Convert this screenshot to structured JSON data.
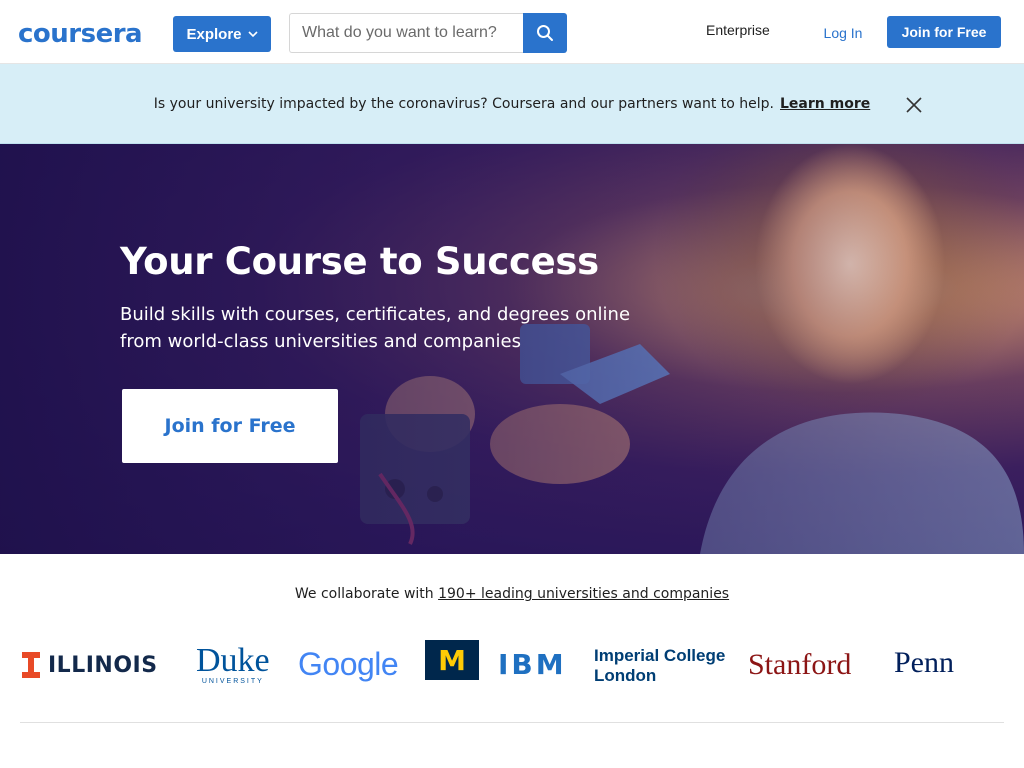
{
  "header": {
    "logo_text": "coursera",
    "explore_label": "Explore",
    "search_placeholder": "What do you want to learn?",
    "search_icon": "search-icon",
    "nav_enterprise": "Enterprise",
    "login_label": "Log In",
    "join_label": "Join for Free"
  },
  "banner": {
    "message": "Is your university impacted by the coronavirus? Coursera and our partners want to help.",
    "link_label": "Learn more",
    "close_icon": "close-icon"
  },
  "hero": {
    "title": "Your Course to Success",
    "subtitle": "Build skills with courses, certificates, and degrees online from world-class universities and companies",
    "cta_label": "Join for Free"
  },
  "partners": {
    "intro": "We collaborate with",
    "intro_link": "190+ leading universities and companies",
    "logos": {
      "illinois": "ILLINOIS",
      "duke": "Duke",
      "duke_sub": "UNIVERSITY",
      "google": "Google",
      "michigan": "M",
      "ibm": "IBM",
      "imperial": "Imperial College",
      "imperial_sub": "London",
      "stanford": "Stanford",
      "penn": "Penn"
    }
  },
  "colors": {
    "brand": "#2a73cc",
    "banner_bg": "#d7eef7",
    "hero_dark": "#2a1759"
  }
}
